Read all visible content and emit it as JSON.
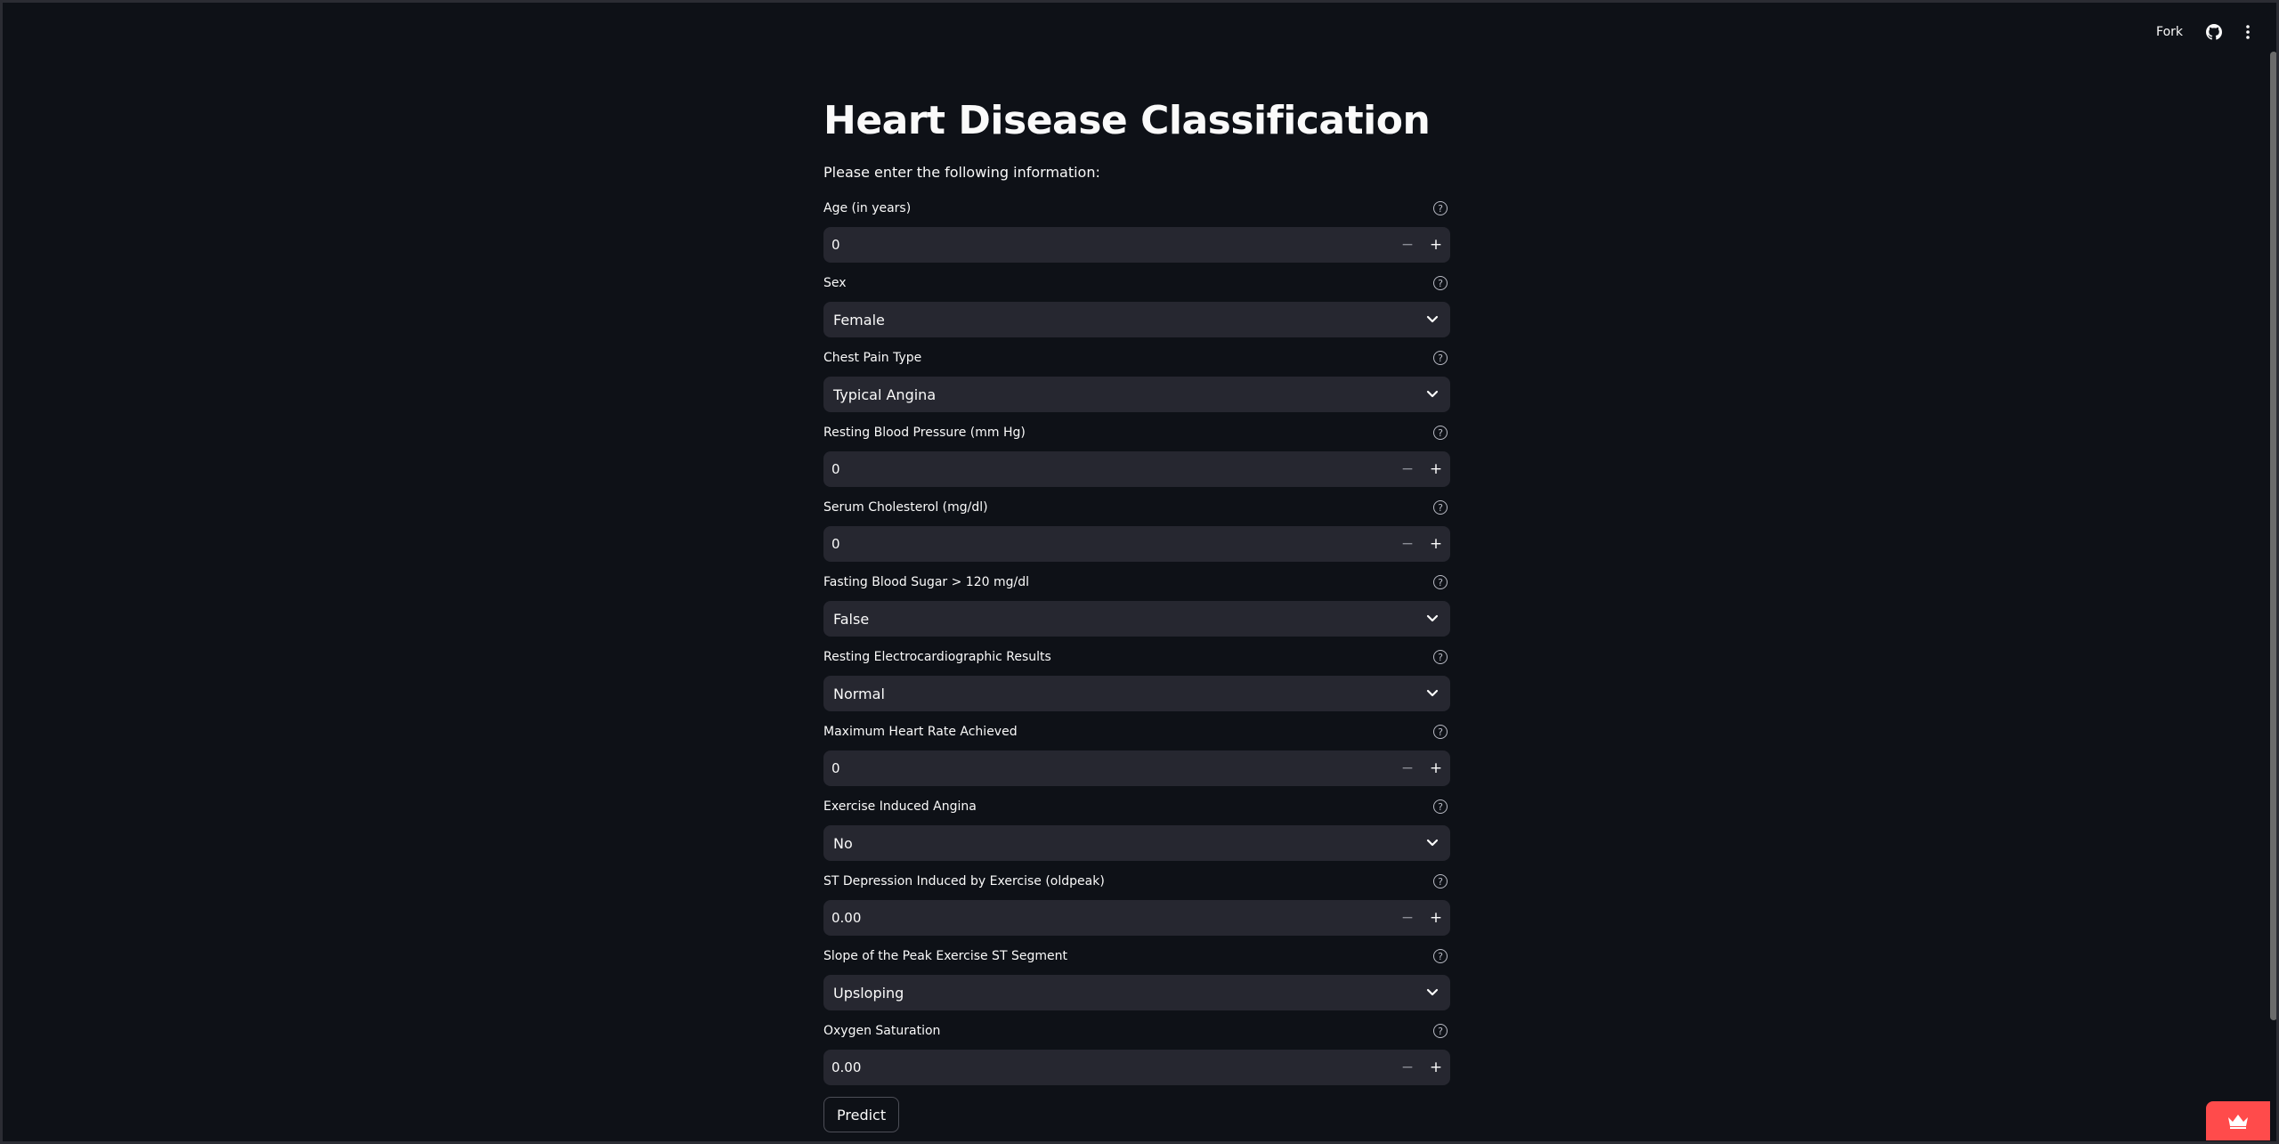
{
  "toolbar": {
    "fork_label": "Fork",
    "github_icon": "github-icon",
    "menu_icon": "more-vertical-icon"
  },
  "page": {
    "title": "Heart Disease Classification",
    "intro": "Please enter the following information:"
  },
  "fields": [
    {
      "label": "Age (in years)",
      "type": "number",
      "value": "0"
    },
    {
      "label": "Sex",
      "type": "select",
      "value": "Female"
    },
    {
      "label": "Chest Pain Type",
      "type": "select",
      "value": "Typical Angina"
    },
    {
      "label": "Resting Blood Pressure (mm Hg)",
      "type": "number",
      "value": "0"
    },
    {
      "label": "Serum Cholesterol (mg/dl)",
      "type": "number",
      "value": "0"
    },
    {
      "label": "Fasting Blood Sugar > 120 mg/dl",
      "type": "select",
      "value": "False"
    },
    {
      "label": "Resting Electrocardiographic Results",
      "type": "select",
      "value": "Normal"
    },
    {
      "label": "Maximum Heart Rate Achieved",
      "type": "number",
      "value": "0"
    },
    {
      "label": "Exercise Induced Angina",
      "type": "select",
      "value": "No"
    },
    {
      "label": "ST Depression Induced by Exercise (oldpeak)",
      "type": "number",
      "value": "0.00"
    },
    {
      "label": "Slope of the Peak Exercise ST Segment",
      "type": "select",
      "value": "Upsloping"
    },
    {
      "label": "Oxygen Saturation",
      "type": "number",
      "value": "0.00"
    }
  ],
  "stepper": {
    "minus": "−",
    "plus": "+"
  },
  "help_glyph": "?",
  "predict_label": "Predict",
  "colors": {
    "accent": "#ff4b4b",
    "background": "#0e1117",
    "input_bg": "#262730"
  }
}
